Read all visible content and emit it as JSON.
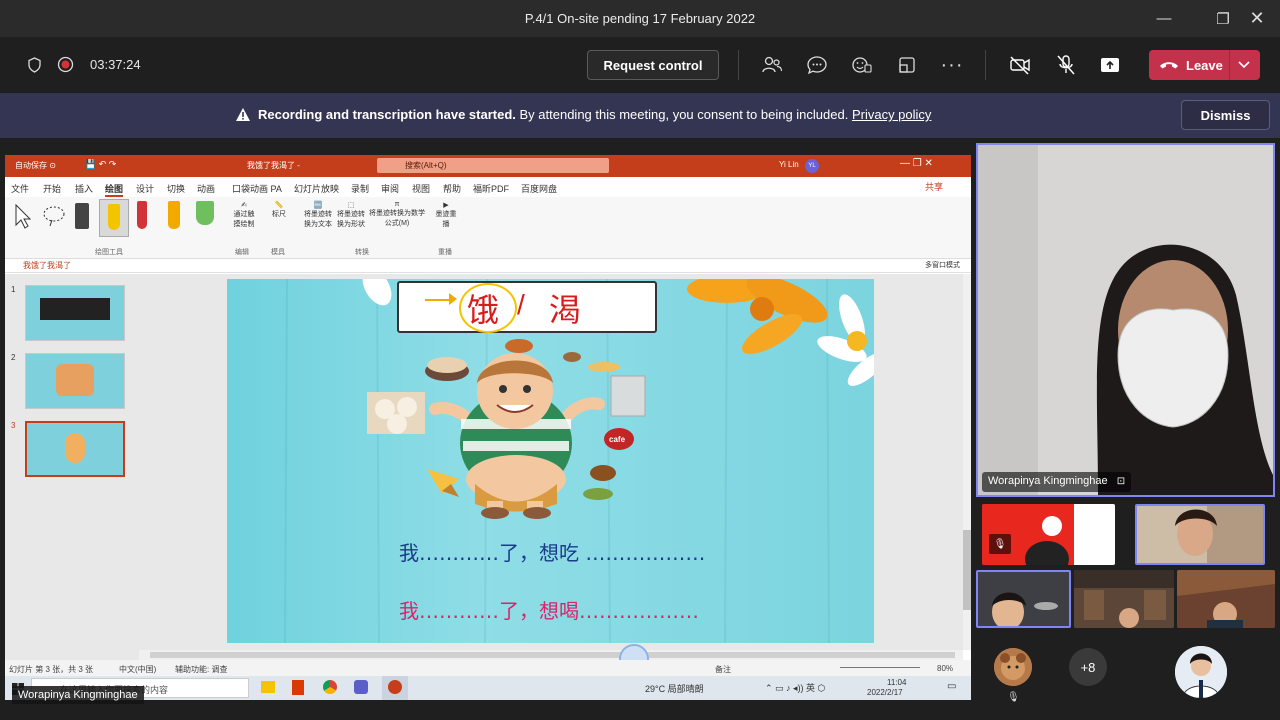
{
  "window": {
    "title": "P.4/1 On-site pending 17 February 2022"
  },
  "toolbar": {
    "timer": "03:37:24",
    "request_control_label": "Request control",
    "leave_label": "Leave"
  },
  "banner": {
    "bold": "Recording and transcription have started.",
    "text": " By attending this meeting, you consent to being included. ",
    "link": "Privacy policy",
    "dismiss_label": "Dismiss"
  },
  "ppt": {
    "title": "我饿了我渴了 -",
    "search_placeholder": "搜索(Alt+Q)",
    "user": "Yi Lin",
    "user_initials": "YL",
    "tabs": [
      "文件",
      "开始",
      "插入",
      "绘图",
      "设计",
      "切换",
      "动画",
      "口袋动画 PA",
      "幻灯片放映",
      "录制",
      "审阅",
      "视图",
      "帮助",
      "福昕PDF",
      "百度网盘"
    ],
    "share_label": "共享",
    "ribbon_groups": [
      "绘图工具",
      "编辑",
      "模具",
      "转换",
      "重播"
    ],
    "ribbon_buttons": [
      "通过触摸绘制",
      "标尺",
      "将墨迹转换为文本",
      "将墨迹转换为形状",
      "将墨迹转换为数学公式(M)",
      "墨迹重播"
    ],
    "doc_tab": "我饿了我渴了",
    "multi_window": "多窗口模式",
    "slide_numbers": [
      "1",
      "2",
      "3"
    ],
    "slide": {
      "choice_left": "饿",
      "choice_sep": "/",
      "choice_right": "渴",
      "line1": "我…………了，想吃 ………………",
      "line2": "我…………了，想喝………………",
      "sticker": "cafe"
    },
    "status": {
      "slide_info": "幻灯片 第 3 张，共 3 张",
      "lang": "中文(中国)",
      "accessibility": "辅助功能: 调查",
      "notes": "备注",
      "zoom": "80%"
    },
    "taskbar": {
      "search": "在这里输入你要搜索的内容",
      "weather": "29°C 局部晴朗",
      "time": "11:04",
      "date": "2022/2/17"
    }
  },
  "participants": {
    "main_name": "Worapinya Kingminghae",
    "presenter_name": "Worapinya Kingminghae",
    "overflow_count": "+8"
  },
  "colors": {
    "leave": "#c4314b",
    "banner": "#343552",
    "active_border": "#7f85f5",
    "ppt_red": "#c43e1c"
  }
}
